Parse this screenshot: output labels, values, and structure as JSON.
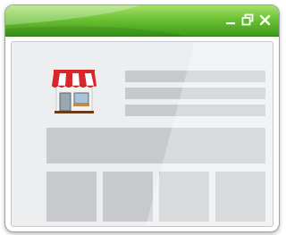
{
  "window": {
    "title_bar_color": "#5cb82a",
    "controls": [
      {
        "icon": "minimize-icon",
        "label": "minimize"
      },
      {
        "icon": "restore-icon",
        "label": "restore"
      },
      {
        "icon": "close-icon",
        "label": "close"
      }
    ]
  },
  "content": {
    "icon": "storefront-icon",
    "placeholder_color": "#c7c9cc",
    "awning_colors": [
      "#d9262b",
      "#ffffff"
    ]
  }
}
